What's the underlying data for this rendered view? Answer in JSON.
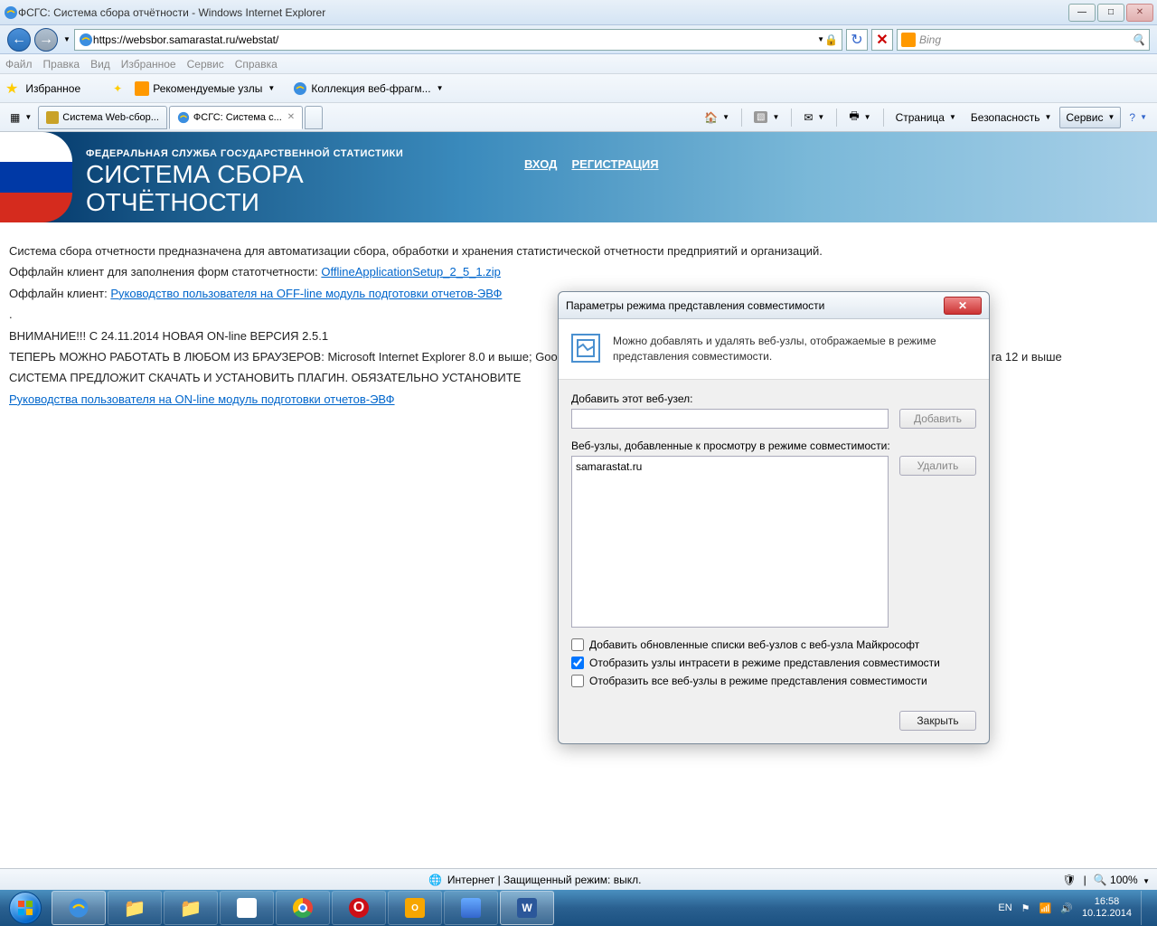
{
  "titlebar": {
    "title": "ФСГС: Система сбора отчётности - Windows Internet Explorer"
  },
  "address": {
    "url": "https://websbor.samarastat.ru/webstat/",
    "search_placeholder": "Bing"
  },
  "menubar": [
    "Файл",
    "Правка",
    "Вид",
    "Избранное",
    "Сервис",
    "Справка"
  ],
  "favbar": {
    "favorites": "Избранное",
    "links": [
      "Рекомендуемые узлы",
      "Коллекция веб-фрагм..."
    ]
  },
  "tabs": [
    {
      "label": "Система Web-сбор..."
    },
    {
      "label": "ФСГС: Система с..."
    }
  ],
  "commands": {
    "page": "Страница",
    "safety": "Безопасность",
    "tools": "Сервис"
  },
  "banner": {
    "subtitle": "ФЕДЕРАЛЬНАЯ СЛУЖБА ГОСУДАРСТВЕННОЙ СТАТИСТИКИ",
    "title1": "СИСТЕМА СБОРА",
    "title2": "ОТЧЁТНОСТИ",
    "login": "ВХОД",
    "register": "РЕГИСТРАЦИЯ"
  },
  "content": {
    "p1": "Система сбора отчетности предназначена для автоматизации сбора, обработки и хранения статистической отчетности предприятий и организаций.",
    "p2a": "Оффлайн клиент для заполнения форм статотчетности: ",
    "p2link": "OfflineApplicationSetup_2_5_1.zip",
    "p3a": "Оффлайн клиент: ",
    "p3link": "Руководство пользователя на OFF-line модуль подготовки отчетов-ЭВФ",
    "dot": ".",
    "p4": "ВНИМАНИЕ!!! С 24.11.2014 НОВАЯ ON-line ВЕРСИЯ 2.5.1",
    "p5": "ТЕПЕРЬ МОЖНО РАБОТАТЬ В ЛЮБОМ ИЗ БРАУЗЕРОВ: Microsoft Internet Explorer 8.0 и выше; Goo",
    "p5b": "ra 12 и выше",
    "p6": "СИСТЕМА ПРЕДЛОЖИТ СКАЧАТЬ И УСТАНОВИТЬ ПЛАГИН. ОБЯЗАТЕЛЬНО УСТАНОВИТЕ",
    "p7link": "Руководства пользователя на ON-line модуль подготовки отчетов-ЭВФ"
  },
  "dialog": {
    "title": "Параметры режима представления совместимости",
    "info": "Можно добавлять и удалять веб-узлы, отображаемые в режиме представления совместимости.",
    "add_label": "Добавить этот веб-узел:",
    "add_btn": "Добавить",
    "list_label": "Веб-узлы, добавленные к просмотру в режиме совместимости:",
    "list_item": "samarastat.ru",
    "remove_btn": "Удалить",
    "check1": "Добавить обновленные списки веб-узлов с веб-узла Майкрософт",
    "check2": "Отобразить узлы интрасети в режиме представления совместимости",
    "check3": "Отобразить все веб-узлы в режиме представления совместимости",
    "close_btn": "Закрыть"
  },
  "statusbar": {
    "text": "Интернет | Защищенный режим: выкл.",
    "zoom": "100%"
  },
  "tray": {
    "lang": "EN",
    "time": "16:58",
    "date": "10.12.2014"
  }
}
